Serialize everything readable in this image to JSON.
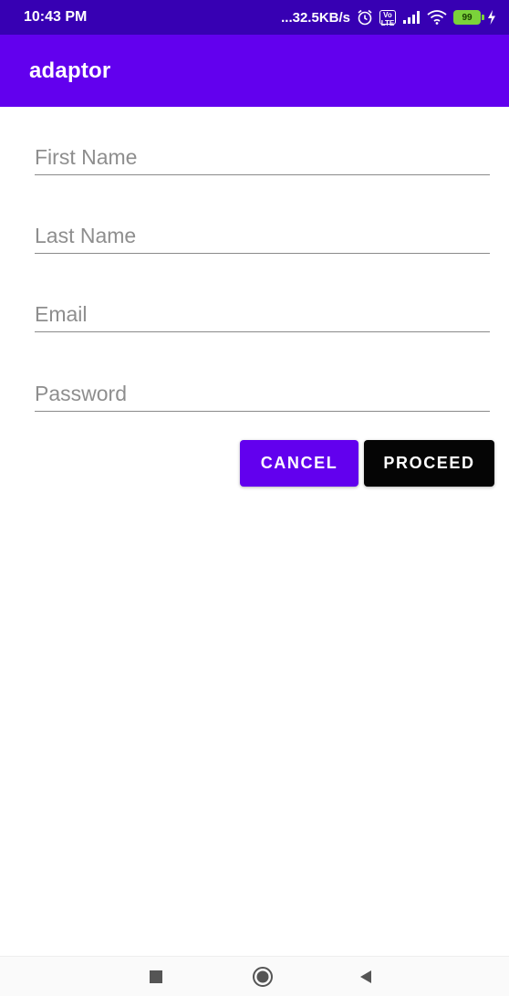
{
  "status_bar": {
    "time": "10:43 PM",
    "network_speed": "...32.5KB/s",
    "volte_label": "Vo\nLTE",
    "battery_level": "99",
    "icons": [
      "alarm-icon",
      "volte-icon",
      "signal-icon",
      "wifi-icon",
      "battery-icon",
      "charging-icon"
    ]
  },
  "app_bar": {
    "title": "adaptor"
  },
  "form": {
    "first_name": {
      "value": "",
      "placeholder": "First Name"
    },
    "last_name": {
      "value": "",
      "placeholder": "Last Name"
    },
    "email": {
      "value": "",
      "placeholder": "Email"
    },
    "password": {
      "value": "",
      "placeholder": "Password"
    }
  },
  "buttons": {
    "cancel": "CANCEL",
    "proceed": "PROCEED"
  },
  "nav_bar": {
    "icons": [
      "recents-icon",
      "home-icon",
      "back-icon"
    ]
  },
  "colors": {
    "status_bar": "#3700b3",
    "app_bar": "#6200ee",
    "cancel_button": "#6200ee",
    "proceed_button": "#050505",
    "battery": "#7bd23a"
  }
}
